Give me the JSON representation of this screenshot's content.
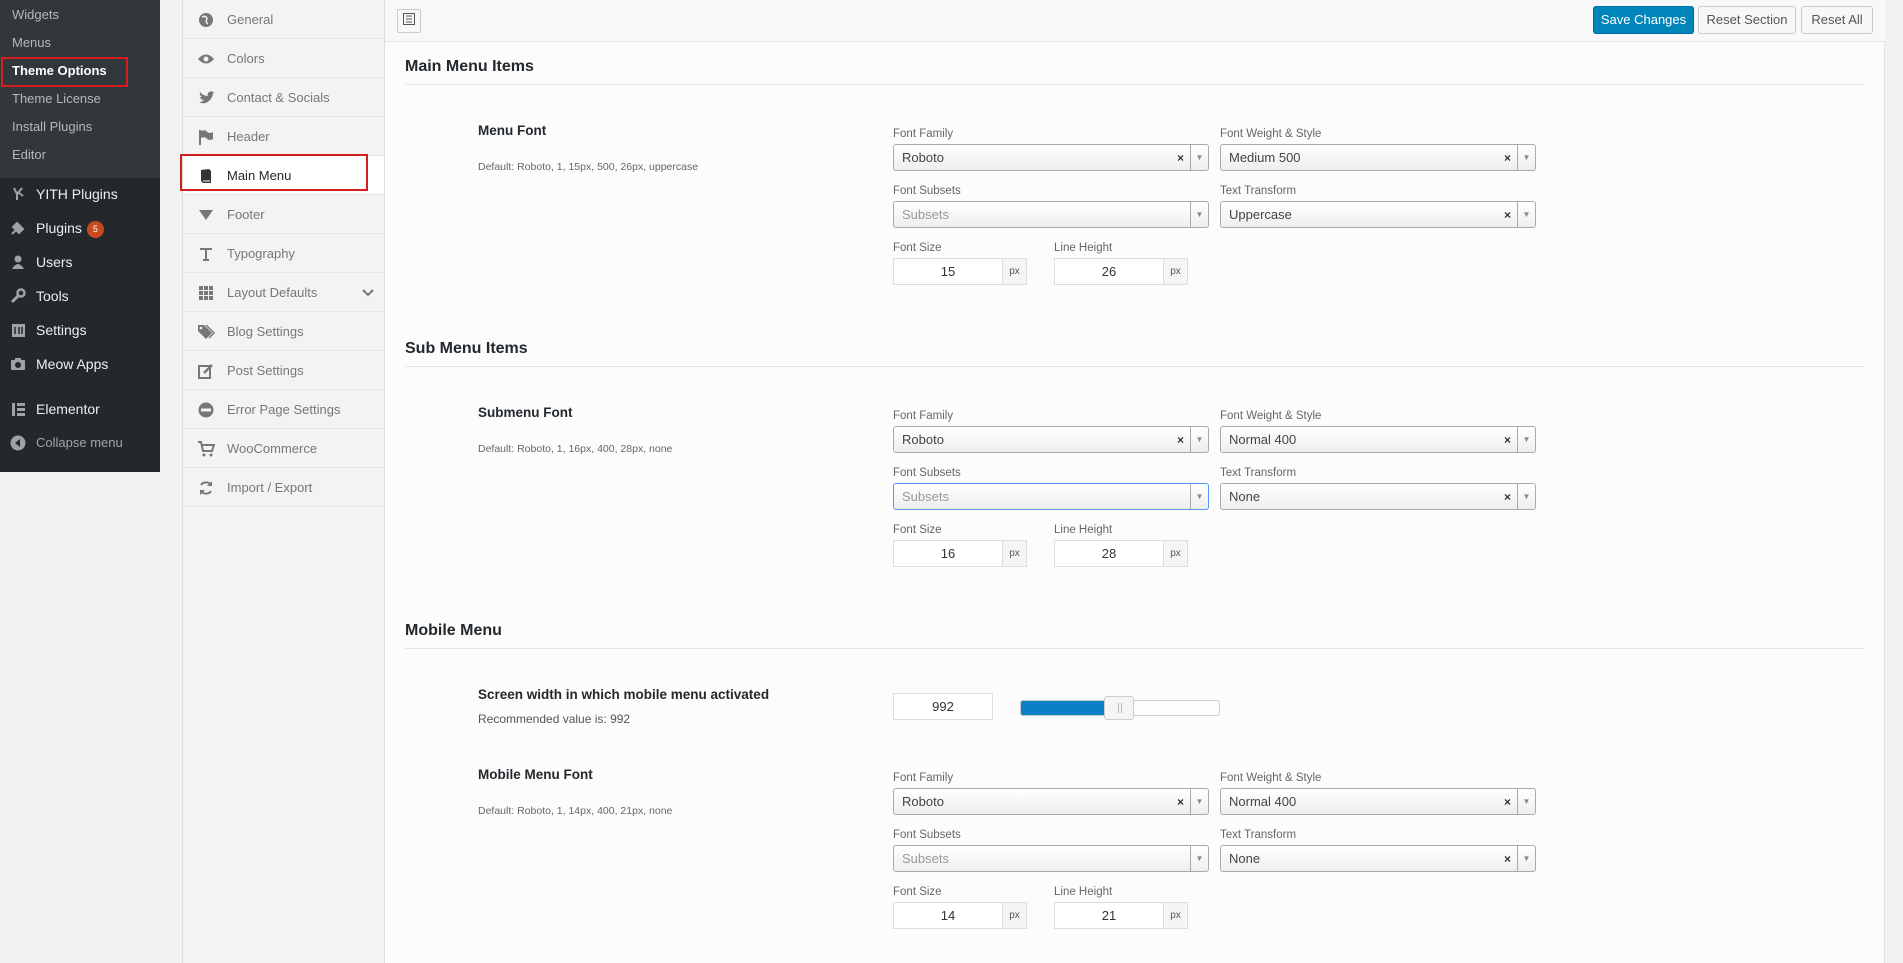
{
  "admin_menu": {
    "submenu": [
      "Widgets",
      "Menus",
      "Theme Options",
      "Theme License",
      "Install Plugins",
      "Editor"
    ],
    "items": [
      "YITH Plugins",
      "Plugins",
      "Users",
      "Tools",
      "Settings",
      "Meow Apps",
      "Elementor"
    ],
    "plugins_badge": "5",
    "collapse_label": "Collapse menu"
  },
  "options_nav": [
    "General",
    "Colors",
    "Contact & Socials",
    "Header",
    "Main Menu",
    "Footer",
    "Typography",
    "Layout Defaults",
    "Blog Settings",
    "Post Settings",
    "Error Page Settings",
    "WooCommerce",
    "Import / Export"
  ],
  "toolbar": {
    "save": "Save Changes",
    "reset_section": "Reset Section",
    "reset_all": "Reset All"
  },
  "labels": {
    "font_family": "Font Family",
    "font_weight": "Font Weight & Style",
    "font_subsets": "Font Subsets",
    "text_transform": "Text Transform",
    "font_size": "Font Size",
    "line_height": "Line Height",
    "subsets_placeholder": "Subsets",
    "px": "px"
  },
  "sections": {
    "main_menu": {
      "title": "Main Menu Items",
      "field": "Menu Font",
      "desc": "Default: Roboto, 1, 15px, 500, 26px, uppercase",
      "family": "Roboto",
      "weight": "Medium 500",
      "transform": "Uppercase",
      "size": "15",
      "line": "26"
    },
    "sub_menu": {
      "title": "Sub Menu Items",
      "field": "Submenu Font",
      "desc": "Default: Roboto, 1, 16px, 400, 28px, none",
      "family": "Roboto",
      "weight": "Normal 400",
      "transform": "None",
      "size": "16",
      "line": "28"
    },
    "mobile": {
      "title": "Mobile Menu",
      "width_title": "Screen width in which mobile menu activated",
      "width_desc": "Recommended value is: 992",
      "width_value": "992",
      "slider_fraction": 0.43,
      "field": "Mobile Menu Font",
      "desc": "Default: Roboto, 1, 14px, 400, 21px, none",
      "family": "Roboto",
      "weight": "Normal 400",
      "transform": "None",
      "size": "14",
      "line": "21"
    }
  },
  "colors": {
    "primary": "#0085ba",
    "admin_bg": "#23282d",
    "highlight": "#d11e1e",
    "badge": "#ca4a1f"
  }
}
